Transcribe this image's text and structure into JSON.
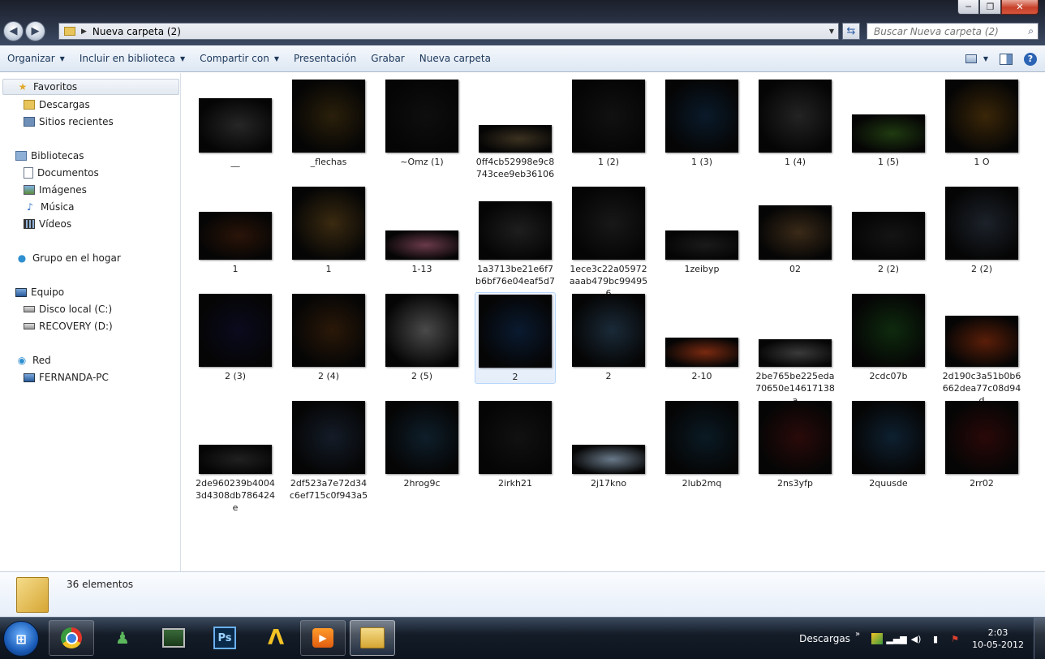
{
  "window": {
    "minimize_label": "─",
    "maximize_label": "❐",
    "close_label": "✕"
  },
  "address": {
    "path": "Nueva carpeta (2)",
    "search_placeholder": "Buscar Nueva carpeta (2)"
  },
  "toolbar": {
    "organize": "Organizar",
    "include_library": "Incluir en biblioteca",
    "share_with": "Compartir con",
    "presentation": "Presentación",
    "burn": "Grabar",
    "new_folder": "Nueva carpeta"
  },
  "nav": {
    "favorites": "Favoritos",
    "downloads": "Descargas",
    "recent_places": "Sitios recientes",
    "libraries": "Bibliotecas",
    "documents": "Documentos",
    "pictures": "Imágenes",
    "music": "Música",
    "videos": "Vídeos",
    "homegroup": "Grupo en el hogar",
    "computer": "Equipo",
    "local_disk": "Disco local (C:)",
    "recovery": "RECOVERY (D:)",
    "network": "Red",
    "network_pc": "FERNANDA-PC"
  },
  "files": [
    {
      "name": "__",
      "bg": "#262626",
      "aspect": 0.74
    },
    {
      "name": "_flechas",
      "bg": "#2a1f0a",
      "aspect": 1
    },
    {
      "name": "~Omz (1)",
      "bg": "#0e0e0e",
      "aspect": 1
    },
    {
      "name": "0ff4cb52998e9c8743cee9eb36106",
      "bg": "#3b3120",
      "aspect": 0.38
    },
    {
      "name": "1 (2)",
      "bg": "#111111",
      "aspect": 1
    },
    {
      "name": "1 (3)",
      "bg": "#0a1a2a",
      "aspect": 1
    },
    {
      "name": "1 (4)",
      "bg": "#232323",
      "aspect": 1
    },
    {
      "name": "1 (5)",
      "bg": "#1f3a10",
      "aspect": 0.52
    },
    {
      "name": "1 O",
      "bg": "#3a2608",
      "aspect": 1
    },
    {
      "name": "1",
      "bg": "#2a1408",
      "aspect": 0.66
    },
    {
      "name": "1",
      "bg": "#3a2a10",
      "aspect": 1
    },
    {
      "name": "1-13",
      "bg": "#6a3a4a",
      "aspect": 0.4
    },
    {
      "name": "1a3713be21e6f7b6bf76e04eaf5d7",
      "bg": "#1e1e1e",
      "aspect": 0.8
    },
    {
      "name": "1ece3c22a05972aaab479bc994956",
      "bg": "#181818",
      "aspect": 1
    },
    {
      "name": "1zeibyp",
      "bg": "#1a1a1a",
      "aspect": 0.4
    },
    {
      "name": "02",
      "bg": "#3a2a18",
      "aspect": 0.74
    },
    {
      "name": "2 (2)",
      "bg": "#141414",
      "aspect": 0.66
    },
    {
      "name": "2 (2)",
      "bg": "#1c222a",
      "aspect": 1
    },
    {
      "name": "2 (3)",
      "bg": "#0a0a1e",
      "aspect": 1
    },
    {
      "name": "2 (4)",
      "bg": "#2a1808",
      "aspect": 1
    },
    {
      "name": "2 (5)",
      "bg": "#4a4a4a",
      "aspect": 1
    },
    {
      "name": "2",
      "bg": "#0a1a30",
      "aspect": 1
    },
    {
      "name": "2",
      "bg": "#1a2a38",
      "aspect": 1
    },
    {
      "name": "2-10",
      "bg": "#7a2a10",
      "aspect": 0.4
    },
    {
      "name": "2be765be225eda70650e14617138a",
      "bg": "#3a3a3a",
      "aspect": 0.38
    },
    {
      "name": "2cdc07b",
      "bg": "#0e2a0e",
      "aspect": 1
    },
    {
      "name": "2d190c3a51b0b6662dea77c08d94d",
      "bg": "#5a1e08",
      "aspect": 0.7
    },
    {
      "name": "2de960239b40043d4308db786424e",
      "bg": "#202020",
      "aspect": 0.4
    },
    {
      "name": "2df523a7e72d34c6ef715c0f943a5",
      "bg": "#141c28",
      "aspect": 1
    },
    {
      "name": "2hrog9c",
      "bg": "#0e1e2a",
      "aspect": 1
    },
    {
      "name": "2irkh21",
      "bg": "#111111",
      "aspect": 1
    },
    {
      "name": "2j17kno",
      "bg": "#6a7a8a",
      "aspect": 0.4
    },
    {
      "name": "2lub2mq",
      "bg": "#0a1a24",
      "aspect": 1
    },
    {
      "name": "2ns3yfp",
      "bg": "#2a0a0a",
      "aspect": 1
    },
    {
      "name": "2quusde",
      "bg": "#0e2030",
      "aspect": 1
    },
    {
      "name": "2rr02",
      "bg": "#2a0808",
      "aspect": 1
    }
  ],
  "status": {
    "count": "36 elementos"
  },
  "taskbar": {
    "tray_label": "Descargas",
    "time": "2:03",
    "date": "10-05-2012"
  }
}
